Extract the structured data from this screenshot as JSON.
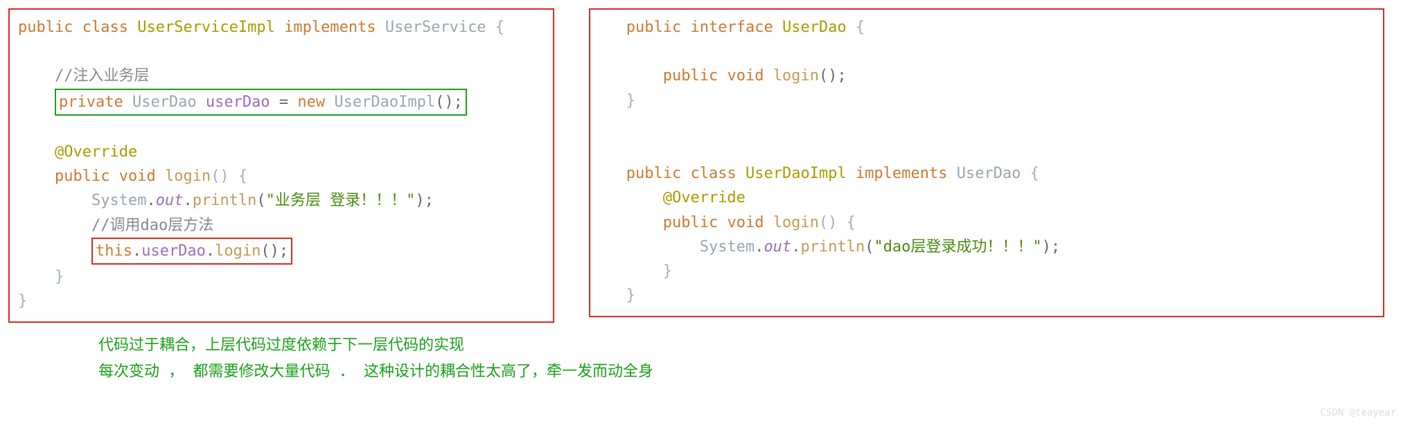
{
  "left": {
    "l1": {
      "kw1": "public",
      "kw2": "class",
      "name": "UserServiceImpl",
      "kw3": "implements",
      "iface": "UserService",
      "brace": " {"
    },
    "comment1": "//注入业务层",
    "field_line": {
      "kw": "private",
      "type": "UserDao",
      "name": "userDao",
      "eq": "=",
      "newkw": "new",
      "ctor": "UserDaoImpl",
      "paren": "();"
    },
    "override": "@Override",
    "method_sig": {
      "kw1": "public",
      "kw2": "void",
      "name": "login",
      "paren": "() {"
    },
    "print_inner": {
      "cls": "System",
      "out": "out",
      "m": "println",
      "arg": "\"业务层 登录！！！\""
    },
    "comment2": "//调用dao层方法",
    "call_line": {
      "thiskw": "this",
      "field": "userDao",
      "m": "login",
      "paren": "();"
    }
  },
  "right": {
    "iface": {
      "kw1": "public",
      "kw2": "interface",
      "name": "UserDao",
      "brace": " {"
    },
    "iface_m": {
      "kw1": "public",
      "kw2": "void",
      "name": "login",
      "paren": "();"
    },
    "impl": {
      "kw1": "public",
      "kw2": "class",
      "name": "UserDaoImpl",
      "kw3": "implements",
      "iface": "UserDao",
      "brace": " {"
    },
    "override": "@Override",
    "method_sig": {
      "kw1": "public",
      "kw2": "void",
      "name": "login",
      "paren": "() {"
    },
    "print_inner": {
      "cls": "System",
      "out": "out",
      "m": "println",
      "arg": "\"dao层登录成功！！！\""
    }
  },
  "caption": {
    "line1": "代码过于耦合，上层代码过度依赖于下一层代码的实现",
    "line2": "每次变动 ， 都需要修改大量代码 ． 这种设计的耦合性太高了，牵一发而动全身"
  },
  "watermark": "CSDN @teayear"
}
